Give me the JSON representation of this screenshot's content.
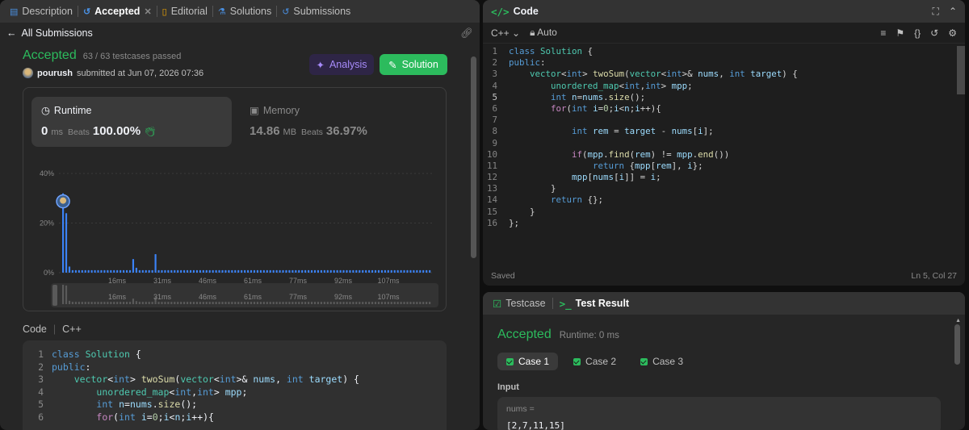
{
  "left_tabs": {
    "description": "Description",
    "accepted": "Accepted",
    "editorial": "Editorial",
    "solutions": "Solutions",
    "submissions": "Submissions"
  },
  "back_label": "All Submissions",
  "submission": {
    "status": "Accepted",
    "testcases": "63 / 63 testcases passed",
    "user": "pourush",
    "submitted_at": "submitted at Jun 07, 2026 07:36",
    "analysis_label": "Analysis",
    "solution_label": "Solution"
  },
  "runtime": {
    "label": "Runtime",
    "value": "0",
    "unit": "ms",
    "beats_label": "Beats",
    "beats": "100.00%"
  },
  "memory": {
    "label": "Memory",
    "value": "14.86",
    "unit": "MB",
    "beats_label": "Beats",
    "beats": "36.97%"
  },
  "chart_data": {
    "type": "bar",
    "ylim": [
      0,
      40
    ],
    "yticks": [
      "40%",
      "20%",
      "0%"
    ],
    "xticks": [
      "16ms",
      "31ms",
      "46ms",
      "61ms",
      "77ms",
      "92ms",
      "107ms"
    ],
    "values": [
      32,
      24,
      2.5,
      1,
      1,
      1,
      1,
      1,
      1,
      1,
      1,
      1,
      1,
      1,
      1,
      1,
      1,
      1,
      1,
      1,
      1,
      1,
      5.5,
      2,
      1,
      1,
      1,
      1,
      1,
      7.5,
      1,
      1,
      1,
      1,
      1,
      1,
      1,
      1,
      1,
      1,
      1,
      1,
      1,
      1,
      1,
      1,
      1,
      1,
      1,
      1,
      1,
      1,
      1,
      1,
      1,
      1,
      1,
      1,
      1,
      1,
      1,
      1,
      1,
      1,
      1,
      1,
      1,
      1,
      1,
      1,
      1,
      1,
      1,
      1,
      1,
      1,
      1,
      1,
      1,
      1,
      1,
      1,
      1,
      1,
      1,
      1,
      1,
      1,
      1,
      1,
      1,
      1,
      1,
      1,
      1,
      1,
      1,
      1,
      1,
      1,
      1,
      1,
      1,
      1,
      1,
      1,
      1,
      1,
      1,
      1,
      1,
      1,
      1,
      1,
      1,
      1
    ],
    "highlight_index": 0,
    "accent": "#3b82f6"
  },
  "code_section": {
    "label": "Code",
    "lang": "C++",
    "lines": [
      "class Solution {",
      "public:",
      "    vector<int> twoSum(vector<int>& nums, int target) {",
      "        unordered_map<int,int> mpp;",
      "        int n=nums.size();",
      "        for(int i=0;i<n;i++){"
    ]
  },
  "editor": {
    "title": "Code",
    "language": "C++",
    "mode": "Auto",
    "saved": "Saved",
    "cursor": "Ln 5, Col 27",
    "lines": [
      "class Solution {",
      "public:",
      "    vector<int> twoSum(vector<int>& nums, int target) {",
      "        unordered_map<int,int> mpp;",
      "        int n=nums.size();",
      "        for(int i=0;i<n;i++){",
      "",
      "            int rem = target - nums[i];",
      "",
      "            if(mpp.find(rem) != mpp.end())",
      "                return {mpp[rem], i};",
      "            mpp[nums[i]] = i;",
      "        }",
      "        return {};",
      "    }",
      "};"
    ]
  },
  "testpanel": {
    "testcase_tab": "Testcase",
    "result_tab": "Test Result",
    "status": "Accepted",
    "runtime": "Runtime: 0 ms",
    "cases": [
      "Case 1",
      "Case 2",
      "Case 3"
    ],
    "input_label": "Input",
    "input_name": "nums =",
    "input_value": "[2,7,11,15]"
  },
  "colors": {
    "accepted": "#2cbb5d",
    "bar": "#3b82f6",
    "analysis": "#a78bfa"
  }
}
